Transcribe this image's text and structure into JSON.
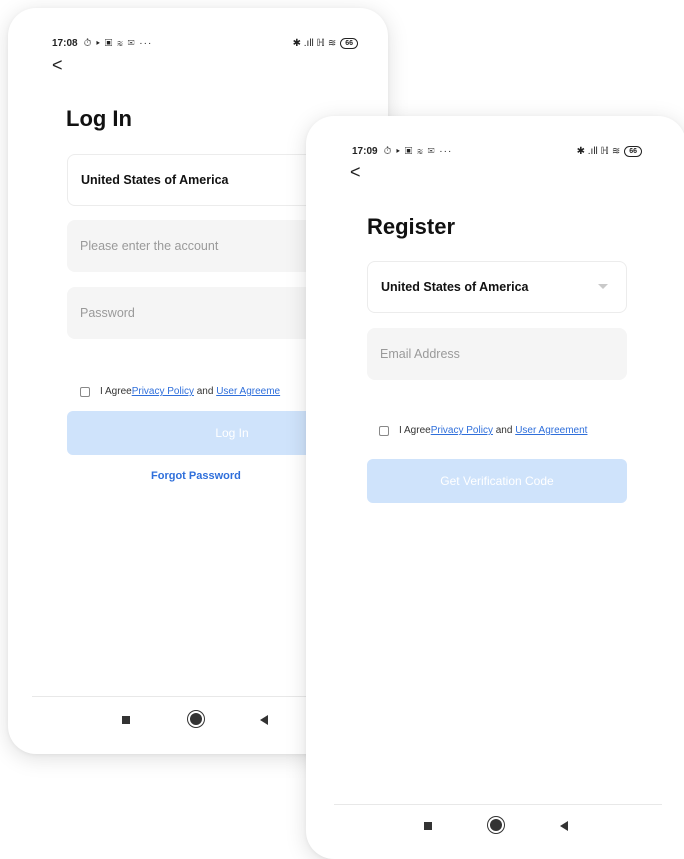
{
  "login": {
    "status": {
      "time": "17:08",
      "icons": "⏱ ▸ ▣ ≋ ✉ ···",
      "signal": "✱ .ıll ℍ ≋",
      "battery": "66"
    },
    "back": "<",
    "title": "Log In",
    "country": "United States of America",
    "account_placeholder": "Please enter the account",
    "password_placeholder": "Password",
    "agree_prefix": "I Agree",
    "privacy_link": "Privacy Policy",
    "and_text": " and ",
    "user_agreement_link": "User Agreeme",
    "login_button": "Log In",
    "forgot_password": "Forgot Password"
  },
  "register": {
    "status": {
      "time": "17:09",
      "icons": "⏱ ▸ ▣ ≋ ✉ ···",
      "signal": "✱ .ıll ℍ ≋",
      "battery": "66"
    },
    "back": "<",
    "title": "Register",
    "country": "United States of America",
    "email_placeholder": "Email Address",
    "agree_prefix": "I Agree",
    "privacy_link": "Privacy Policy",
    "and_text": " and ",
    "user_agreement_link": "User Agreement",
    "verify_button": "Get Verification Code"
  },
  "icons": {
    "nav_home": "square-icon",
    "nav_circle": "home-circle-icon",
    "nav_back": "back-triangle-icon",
    "caret": "chevron-down-icon"
  },
  "colors": {
    "link": "#2f6fdb",
    "button_disabled": "#cfe3fb",
    "field_bg": "#f5f5f5"
  }
}
